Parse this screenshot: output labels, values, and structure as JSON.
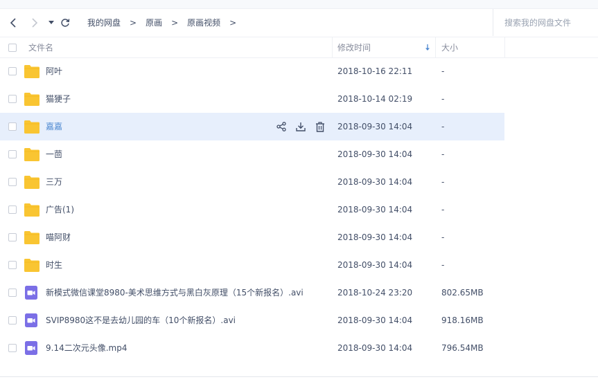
{
  "breadcrumb": {
    "items": [
      "我的网盘",
      "原画",
      "原画视频"
    ],
    "separator": ">"
  },
  "search": {
    "placeholder": "搜索我的网盘文件"
  },
  "columns": {
    "name": "文件名",
    "modified": "修改时间",
    "size": "大小"
  },
  "files": [
    {
      "name": "阿叶",
      "date": "2018-10-16 22:11",
      "size": "-",
      "type": "folder"
    },
    {
      "name": "猫㹴子",
      "date": "2018-10-14 02:19",
      "size": "-",
      "type": "folder"
    },
    {
      "name": "嘉嘉",
      "date": "2018-09-30 14:04",
      "size": "-",
      "type": "folder",
      "hovered": true
    },
    {
      "name": "一茴",
      "date": "2018-09-30 14:04",
      "size": "-",
      "type": "folder"
    },
    {
      "name": "三万",
      "date": "2018-09-30 14:04",
      "size": "-",
      "type": "folder"
    },
    {
      "name": "广告(1)",
      "date": "2018-09-30 14:04",
      "size": "-",
      "type": "folder"
    },
    {
      "name": "喵阿财",
      "date": "2018-09-30 14:04",
      "size": "-",
      "type": "folder"
    },
    {
      "name": "时生",
      "date": "2018-09-30 14:04",
      "size": "-",
      "type": "folder"
    },
    {
      "name": "新模式微信课堂8980-美术思维方式与黑白灰原理（15个新报名）.avi",
      "date": "2018-10-24 23:20",
      "size": "802.65MB",
      "type": "video"
    },
    {
      "name": "SVIP8980这不是去幼儿园的车（10个新报名）.avi",
      "date": "2018-09-30 14:04",
      "size": "918.16MB",
      "type": "video"
    },
    {
      "name": "9.14二次元头像.mp4",
      "date": "2018-09-30 14:04",
      "size": "796.54MB",
      "type": "video"
    }
  ],
  "colors": {
    "folder": "#f9c532",
    "video": "#7b6fe6",
    "hover_row": "#e7effc",
    "link": "#4d88d1",
    "sort_arrow": "#4d88d1"
  },
  "icons": {
    "back": "chevron-left-icon",
    "forward": "chevron-right-icon",
    "history": "caret-down-icon",
    "refresh": "refresh-icon",
    "share": "share-icon",
    "download": "download-icon",
    "delete": "trash-icon",
    "sort": "sort-down-icon",
    "folder": "folder-icon",
    "video": "video-file-icon"
  }
}
